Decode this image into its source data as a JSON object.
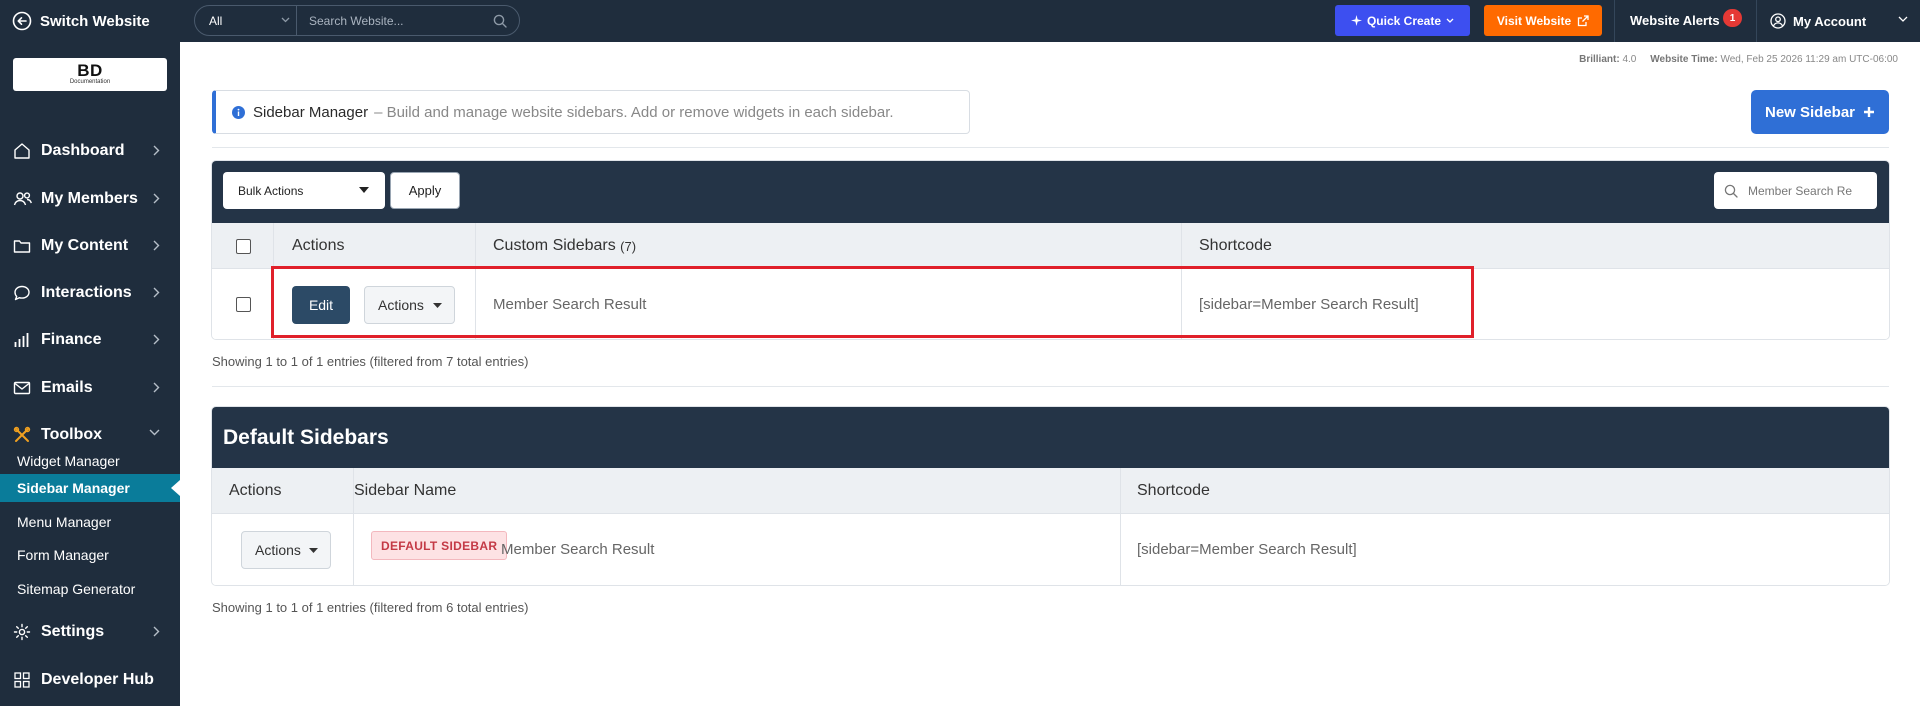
{
  "topbar": {
    "switch_label": "Switch Website",
    "search_scope": "All",
    "search_placeholder": "Search Website...",
    "quick_create": "Quick Create",
    "visit_website": "Visit Website",
    "alerts_label": "Website Alerts",
    "alerts_count": "1",
    "account_label": "My Account",
    "quick_create_color": "#3d4ff0",
    "visit_color": "#ff6a00"
  },
  "sidebar": {
    "logo_text": "BD",
    "logo_sub": "Documentation",
    "items": [
      {
        "label": "Dashboard",
        "icon": "home-icon"
      },
      {
        "label": "My Members",
        "icon": "users-icon"
      },
      {
        "label": "My Content",
        "icon": "folder-icon"
      },
      {
        "label": "Interactions",
        "icon": "chat-icon"
      },
      {
        "label": "Finance",
        "icon": "bar-chart-icon"
      },
      {
        "label": "Emails",
        "icon": "mail-icon"
      },
      {
        "label": "Toolbox",
        "icon": "tools-icon"
      },
      {
        "label": "Settings",
        "icon": "gear-icon"
      },
      {
        "label": "Developer Hub",
        "icon": "grid-icon"
      }
    ],
    "toolbox_sub": [
      "Widget Manager",
      "Sidebar Manager",
      "Menu Manager",
      "Form Manager",
      "Sitemap Generator"
    ],
    "active_color": "#0a7c9a"
  },
  "status": {
    "version_label": "Brilliant:",
    "version": "4.0",
    "time_label": "Website Time:",
    "time": "Wed, Feb 25 2026 11:29 am UTC-06:00"
  },
  "info": {
    "title": "Sidebar Manager",
    "description": "– Build and manage website sidebars. Add or remove widgets in each sidebar."
  },
  "new_sidebar_label": "New Sidebar",
  "custom_table": {
    "bulk_label": "Bulk Actions",
    "apply_label": "Apply",
    "filter_placeholder": "Member Search Re",
    "headers": {
      "actions": "Actions",
      "sidebars": "Custom Sidebars",
      "count": "(7)",
      "shortcode": "Shortcode"
    },
    "rows": [
      {
        "edit": "Edit",
        "actions": "Actions",
        "name": "Member Search Result",
        "shortcode": "[sidebar=Member Search Result]"
      }
    ],
    "footer": "Showing 1 to 1 of 1 entries (filtered from 7 total entries)"
  },
  "default_table": {
    "title": "Default Sidebars",
    "headers": {
      "actions": "Actions",
      "name": "Sidebar Name",
      "shortcode": "Shortcode"
    },
    "rows": [
      {
        "actions": "Actions",
        "badge": "DEFAULT SIDEBAR",
        "name": "Member Search Result",
        "shortcode": "[sidebar=Member Search Result]"
      }
    ],
    "footer": "Showing 1 to 1 of 1 entries (filtered from 6 total entries)"
  }
}
